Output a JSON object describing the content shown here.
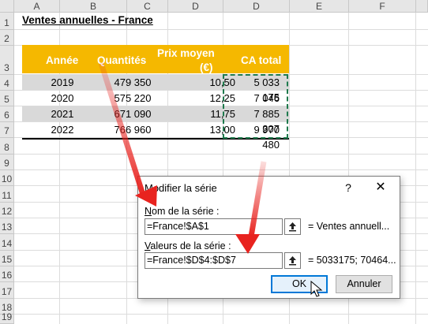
{
  "spreadsheet": {
    "columns": [
      "A",
      "B",
      "C",
      "D",
      "E",
      "F"
    ],
    "rows": [
      "1",
      "2",
      "3",
      "4",
      "5",
      "6",
      "7",
      "8",
      "9",
      "10",
      "11",
      "12",
      "13",
      "14",
      "15",
      "16",
      "17",
      "18",
      "19"
    ],
    "title": "Ventes annuelles - France",
    "headers": {
      "annee": "Année",
      "quantites": "Quantités",
      "prix_line1": "Prix moyen",
      "prix_line2": "(€)",
      "ca": "CA total"
    },
    "data": [
      {
        "annee": "2019",
        "quantites": "479 350",
        "prix": "10,50",
        "ca": "5 033 175"
      },
      {
        "annee": "2020",
        "quantites": "575 220",
        "prix": "12,25",
        "ca": "7 046 445"
      },
      {
        "annee": "2021",
        "quantites": "671 090",
        "prix": "11,75",
        "ca": "7 885 307"
      },
      {
        "annee": "2022",
        "quantites": "766 960",
        "prix": "13,00",
        "ca": "9 970 480"
      }
    ],
    "header_color": "#f5b800",
    "shade_color": "#d9d9d9"
  },
  "dialog": {
    "title": "Modifier la série",
    "help": "?",
    "close": "✕",
    "nom_label_prefix": "N",
    "nom_label_rest": "om de la série :",
    "nom_value": "=France!$A$1",
    "nom_preview": "= Ventes annuell...",
    "valeurs_label_prefix": "V",
    "valeurs_label_rest": "aleurs de la série :",
    "valeurs_value": "=France!$D$4:$D$7",
    "valeurs_preview": "= 5033175; 70464...",
    "ok_label": "OK",
    "cancel_label": "Annuler",
    "pick_icon": "collapse-dialog-icon"
  },
  "annotation": {
    "arrow_color": "#e8231f"
  }
}
